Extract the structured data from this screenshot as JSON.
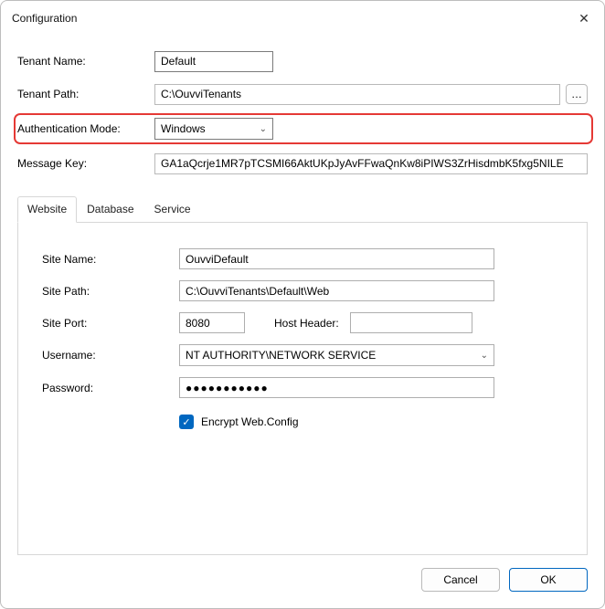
{
  "window": {
    "title": "Configuration",
    "close_icon": "✕"
  },
  "top": {
    "tenantName": {
      "label": "Tenant Name:",
      "value": "Default"
    },
    "tenantPath": {
      "label": "Tenant Path:",
      "value": "C:\\OuvviTenants",
      "browse": "…"
    },
    "authMode": {
      "label": "Authentication Mode:",
      "selected": "Windows"
    },
    "messageKey": {
      "label": "Message Key:",
      "value": "GA1aQcrje1MR7pTCSMI66AktUKpJyAvFFwaQnKw8iPIWS3ZrHisdmbK5fxg5NILE"
    }
  },
  "tabs": {
    "website": "Website",
    "database": "Database",
    "service": "Service"
  },
  "website": {
    "siteName": {
      "label": "Site Name:",
      "value": "OuvviDefault"
    },
    "sitePath": {
      "label": "Site Path:",
      "value": "C:\\OuvviTenants\\Default\\Web"
    },
    "sitePort": {
      "label": "Site Port:",
      "value": "8080"
    },
    "hostHeader": {
      "label": "Host Header:",
      "value": ""
    },
    "username": {
      "label": "Username:",
      "value": "NT AUTHORITY\\NETWORK SERVICE"
    },
    "password": {
      "label": "Password:",
      "value": "●●●●●●●●●●●"
    },
    "encrypt": {
      "label": "Encrypt Web.Config",
      "checked": true
    }
  },
  "footer": {
    "cancel": "Cancel",
    "ok": "OK"
  }
}
